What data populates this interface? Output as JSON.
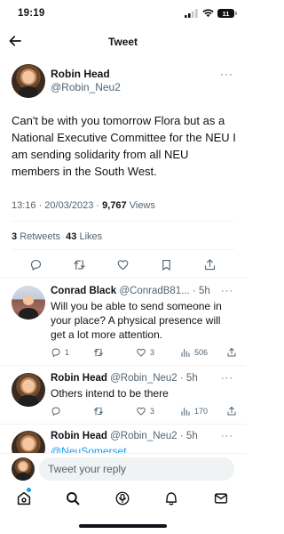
{
  "status_bar": {
    "time": "19:19",
    "battery": "11"
  },
  "header": {
    "title": "Tweet"
  },
  "main_tweet": {
    "author_name": "Robin Head",
    "author_handle": "@Robin_Neu2",
    "more": "···",
    "text": "Can't be with you tomorrow Flora but as a National Executive Committee for the NEU I am sending solidarity from all NEU members in the South West.",
    "time": "13:16 · 20/03/2023 ·",
    "views_count": "9,767",
    "views_label": "Views",
    "retweets_count": "3",
    "retweets_label": "Retweets",
    "likes_count": "43",
    "likes_label": "Likes"
  },
  "replies": [
    {
      "name": "Conrad Black",
      "handle": "@ConradB81...",
      "time": "· 5h",
      "text": "Will you be able to send someone in your place? A physical presence will get a lot more attention.",
      "replies": "1",
      "retweets": "",
      "likes": "3",
      "views": "506"
    },
    {
      "name": "Robin Head",
      "handle": "@Robin_Neu2",
      "time": "· 5h",
      "text": "Others intend to be there",
      "replies": "",
      "retweets": "",
      "likes": "3",
      "views": "170"
    },
    {
      "name": "Robin Head",
      "handle": "@Robin_Neu2",
      "time": "· 5h",
      "text": "@NeuSomerset"
    }
  ],
  "compose": {
    "placeholder": "Tweet your reply"
  },
  "colors": {
    "accent": "#1d9bf0",
    "text": "#0f1419",
    "muted": "#536471",
    "divider": "#eff3f4"
  },
  "icons": [
    "back-arrow-icon",
    "reply-icon",
    "retweet-icon",
    "like-icon",
    "bookmark-icon",
    "share-icon",
    "views-icon",
    "home-icon",
    "search-icon",
    "spaces-icon",
    "notifications-icon",
    "messages-icon"
  ]
}
